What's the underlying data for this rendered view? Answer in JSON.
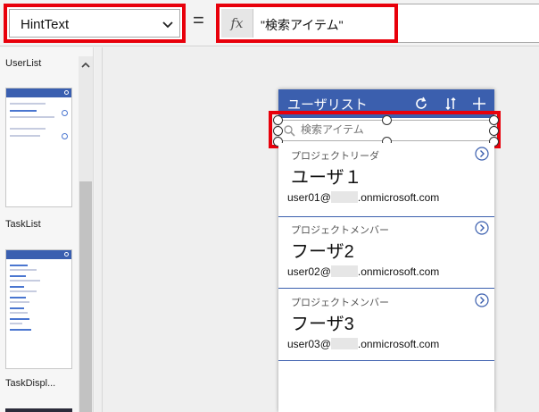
{
  "formula_bar": {
    "property": "HintText",
    "equals": "=",
    "fx_label": "fx",
    "formula": "\"検索アイテム\""
  },
  "screens": {
    "items": [
      {
        "label": "UserList"
      },
      {
        "label": "TaskList"
      },
      {
        "label": "TaskDispl..."
      }
    ]
  },
  "app": {
    "title": "ユーザリスト",
    "icons": [
      "refresh-icon",
      "sort-icon",
      "add-icon"
    ],
    "search_placeholder": "検索アイテム",
    "accent_color": "#3b5fae",
    "highlight_color": "#e8000b"
  },
  "list": {
    "items": [
      {
        "subtitle": "プロジェクトリーダ",
        "name": "ユーザ１",
        "email_prefix": "user01@",
        "email_suffix": ".onmicrosoft.com"
      },
      {
        "subtitle": "プロジェクトメンバー",
        "name": "フーザ2",
        "email_prefix": "user02@",
        "email_suffix": ".onmicrosoft.com"
      },
      {
        "subtitle": "プロジェクトメンバー",
        "name": "フーザ3",
        "email_prefix": "user03@",
        "email_suffix": ".onmicrosoft.com"
      }
    ]
  }
}
